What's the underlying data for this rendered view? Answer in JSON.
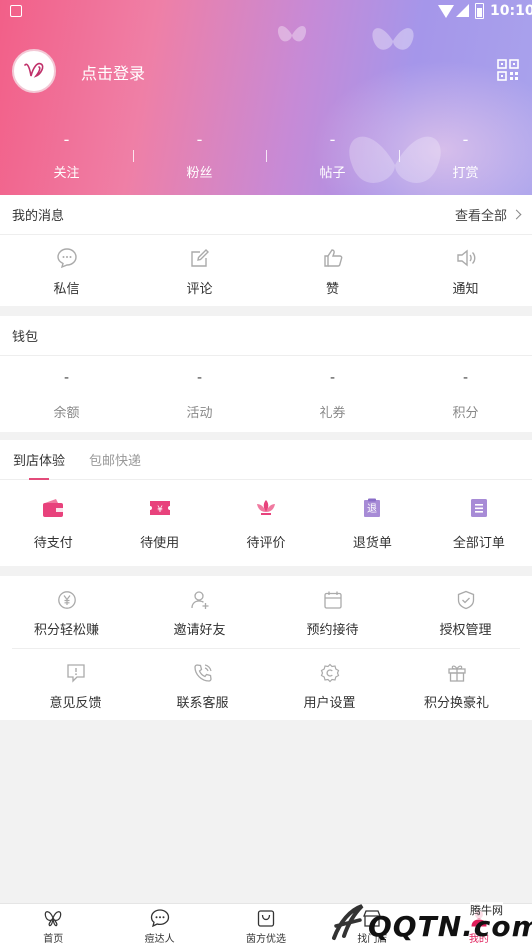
{
  "status_bar": {
    "time": "10:10"
  },
  "header": {
    "login_text": "点击登录",
    "stats": [
      {
        "value": "-",
        "label": "关注"
      },
      {
        "value": "-",
        "label": "粉丝"
      },
      {
        "value": "-",
        "label": "帖子"
      },
      {
        "value": "-",
        "label": "打赏"
      }
    ]
  },
  "messages": {
    "title": "我的消息",
    "view_all": "查看全部",
    "items": [
      {
        "label": "私信",
        "icon": "chat-icon"
      },
      {
        "label": "评论",
        "icon": "edit-icon"
      },
      {
        "label": "赞",
        "icon": "thumbs-up-icon"
      },
      {
        "label": "通知",
        "icon": "speaker-icon"
      }
    ]
  },
  "wallet": {
    "title": "钱包",
    "items": [
      {
        "value": "-",
        "label": "余额"
      },
      {
        "value": "-",
        "label": "活动"
      },
      {
        "value": "-",
        "label": "礼券"
      },
      {
        "value": "-",
        "label": "积分"
      }
    ]
  },
  "orders": {
    "tabs": [
      {
        "label": "到店体验",
        "active": true
      },
      {
        "label": "包邮快递",
        "active": false
      }
    ],
    "items": [
      {
        "label": "待支付",
        "icon": "wallet-icon"
      },
      {
        "label": "待使用",
        "icon": "ticket-icon"
      },
      {
        "label": "待评价",
        "icon": "lotus-icon"
      },
      {
        "label": "退货单",
        "icon": "refund-icon",
        "icon_text": "退"
      },
      {
        "label": "全部订单",
        "icon": "order-list-icon"
      }
    ]
  },
  "services": {
    "rows": [
      [
        {
          "label": "积分轻松赚",
          "icon": "yen-coin-icon"
        },
        {
          "label": "邀请好友",
          "icon": "add-user-icon"
        },
        {
          "label": "预约接待",
          "icon": "calendar-icon"
        },
        {
          "label": "授权管理",
          "icon": "shield-check-icon"
        }
      ],
      [
        {
          "label": "意见反馈",
          "icon": "feedback-icon"
        },
        {
          "label": "联系客服",
          "icon": "phone-icon"
        },
        {
          "label": "用户设置",
          "icon": "settings-icon"
        },
        {
          "label": "积分换豪礼",
          "icon": "gift-icon"
        }
      ]
    ]
  },
  "bottom_nav": [
    {
      "label": "首页",
      "icon": "butterfly-icon",
      "active": false
    },
    {
      "label": "痘达人",
      "icon": "chat-bubble-icon",
      "active": false
    },
    {
      "label": "茵方优选",
      "icon": "shopping-bag-icon",
      "active": false
    },
    {
      "label": "找门店",
      "icon": "store-icon",
      "active": false
    },
    {
      "label": "我的",
      "icon": "profile-icon",
      "active": true
    }
  ],
  "watermark": {
    "line1": "腾牛网",
    "line2": "QQTN.com"
  },
  "colors": {
    "accent": "#e34b7a",
    "icon_gray": "#aaaaaa",
    "order_icon": "#e8427c",
    "order_icon_purple": "#a78bd6"
  }
}
